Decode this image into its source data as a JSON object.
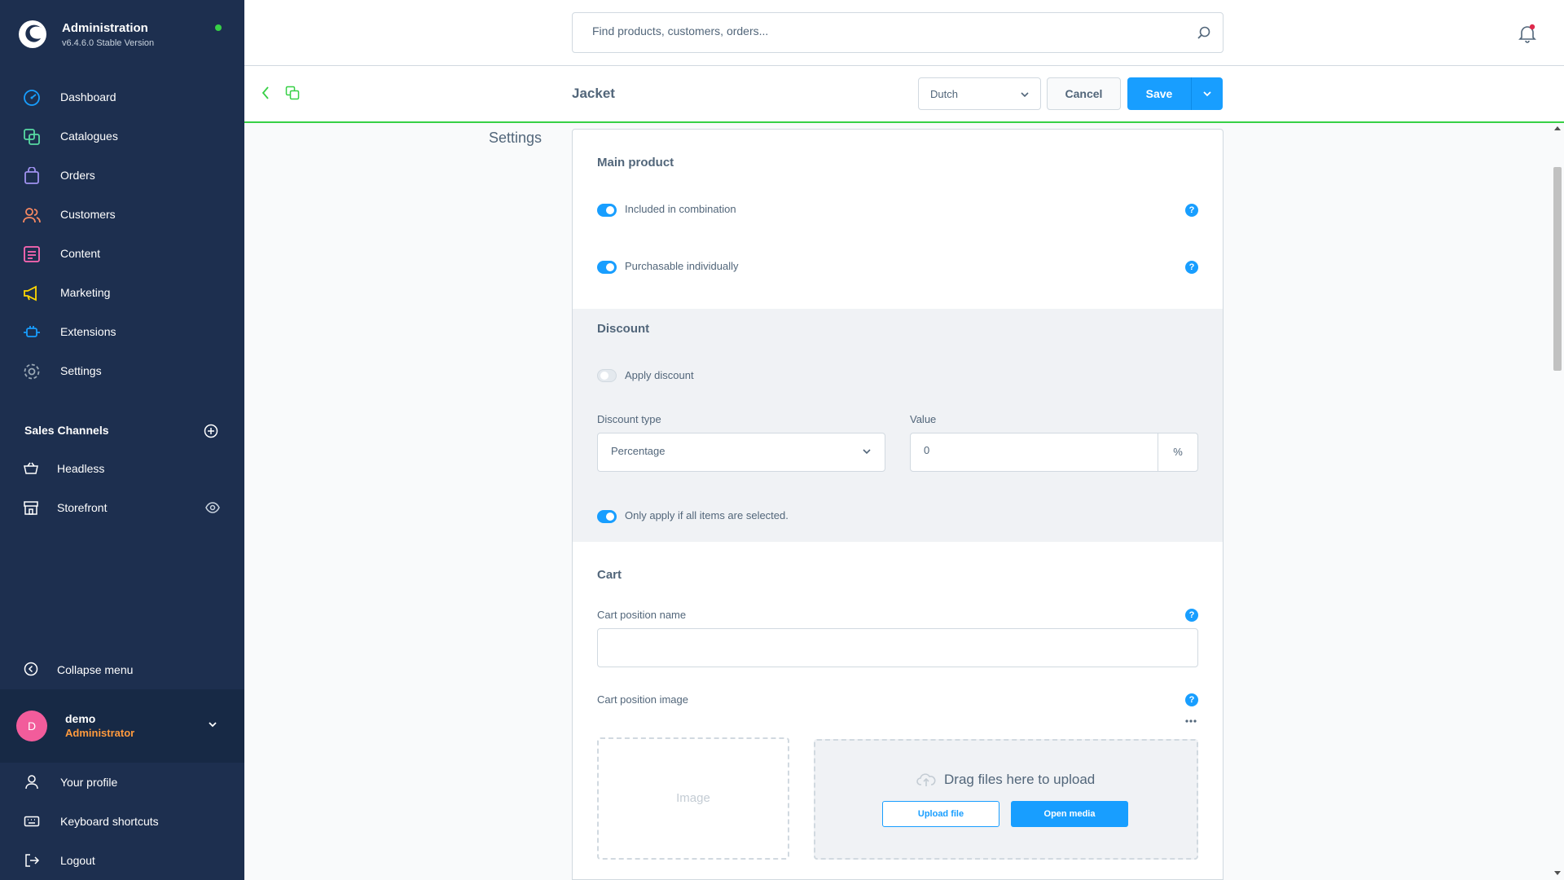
{
  "brand": {
    "title": "Administration",
    "version": "v6.4.6.0 Stable Version",
    "status_color": "#37d046"
  },
  "nav": [
    {
      "label": "Dashboard",
      "icon": "dashboard-icon",
      "color": "#189eff"
    },
    {
      "label": "Catalogues",
      "icon": "catalogue-icon",
      "color": "#57d9a3"
    },
    {
      "label": "Orders",
      "icon": "orders-bag-icon",
      "color": "#a092f0"
    },
    {
      "label": "Customers",
      "icon": "customers-icon",
      "color": "#f88962"
    },
    {
      "label": "Content",
      "icon": "content-icon",
      "color": "#ff68b4"
    },
    {
      "label": "Marketing",
      "icon": "marketing-megaphone-icon",
      "color": "#ffd700"
    },
    {
      "label": "Extensions",
      "icon": "extensions-plug-icon",
      "color": "#189eff"
    },
    {
      "label": "Settings",
      "icon": "gear-icon",
      "color": "#9aa8b5"
    }
  ],
  "sales_channels": {
    "title": "Sales Channels",
    "items": [
      {
        "label": "Headless",
        "icon": "basket-icon"
      },
      {
        "label": "Storefront",
        "icon": "storefront-icon"
      }
    ]
  },
  "collapse_label": "Collapse menu",
  "user": {
    "initial": "D",
    "name": "demo",
    "role": "Administrator"
  },
  "footer": [
    {
      "label": "Your profile",
      "icon": "user-icon"
    },
    {
      "label": "Keyboard shortcuts",
      "icon": "keyboard-icon"
    },
    {
      "label": "Logout",
      "icon": "logout-icon"
    }
  ],
  "search": {
    "placeholder": "Find products, customers, orders..."
  },
  "smartbar": {
    "title": "Jacket",
    "language": "Dutch",
    "cancel_label": "Cancel",
    "save_label": "Save"
  },
  "settings_label": "Settings",
  "main_product": {
    "title": "Main product",
    "included_label": "Included in combination",
    "included_on": true,
    "purchasable_label": "Purchasable individually",
    "purchasable_on": true
  },
  "discount": {
    "title": "Discount",
    "apply_label": "Apply discount",
    "apply_on": false,
    "type_label": "Discount type",
    "type_value": "Percentage",
    "value_label": "Value",
    "value": "0",
    "value_suffix": "%",
    "only_all_label": "Only apply if all items are selected.",
    "only_all_on": true
  },
  "cart": {
    "title": "Cart",
    "position_name_label": "Cart position name",
    "position_name_value": "",
    "position_image_label": "Cart position image",
    "image_placeholder": "Image",
    "drop_text": "Drag files here to upload",
    "upload_label": "Upload file",
    "media_label": "Open media"
  },
  "help_glyph": "?",
  "colors": {
    "sidebar_bg": "#1d2f4f",
    "accent": "#189eff",
    "success": "#37d046",
    "text": "#52667a",
    "role": "#ff9a3d"
  }
}
